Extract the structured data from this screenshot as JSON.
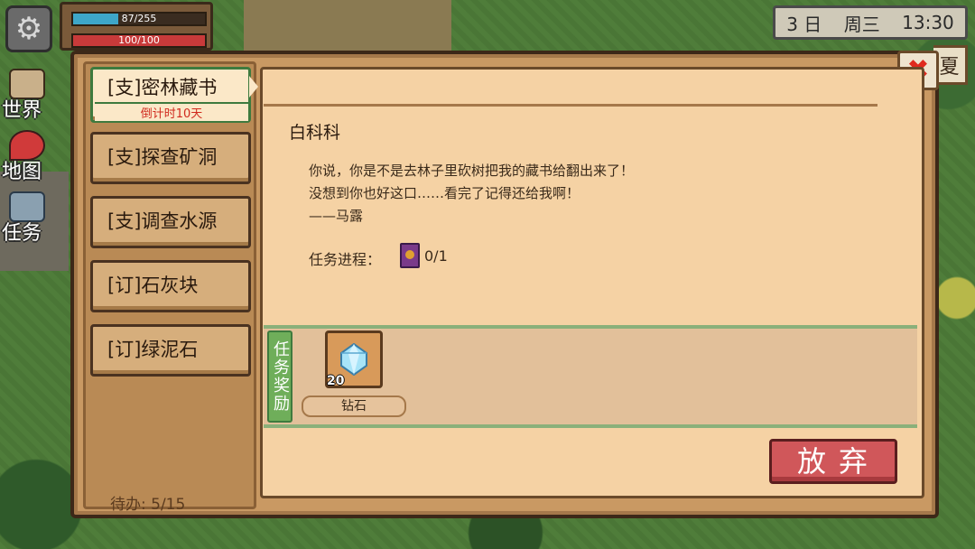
{
  "hud": {
    "energy_text": "87/255",
    "energy_fraction": 0.34,
    "health_text": "100/100",
    "health_fraction": 1.0
  },
  "date": {
    "day": "3 日",
    "weekday": "周三",
    "time": "13:30",
    "season": "夏"
  },
  "side_menu": [
    {
      "label": "世界",
      "icon": "people-icon"
    },
    {
      "label": "地图",
      "icon": "map-pin-icon"
    },
    {
      "label": "任务",
      "icon": "quest-scroll-icon"
    }
  ],
  "quests": [
    {
      "title": "[支]密林藏书",
      "countdown": "倒计时10天",
      "active": true
    },
    {
      "title": "[支]探查矿洞"
    },
    {
      "title": "[支]调查水源"
    },
    {
      "title": "[订]石灰块"
    },
    {
      "title": "[订]绿泥石"
    }
  ],
  "pending": "待办:  5/15",
  "detail": {
    "npc": "白科科",
    "lines": [
      "你说，你是不是去林子里砍树把我的藏书给翻出来了！",
      "没想到你也好这口……看完了记得还给我啊！",
      "——马露"
    ],
    "progress_label": "任务进程：",
    "progress_icon": "book-icon",
    "progress_value": "0/1"
  },
  "reward": {
    "section_label": "任务奖励",
    "items": [
      {
        "name": "钻石",
        "count": "20",
        "icon": "diamond-icon"
      }
    ]
  },
  "buttons": {
    "abandon": "放弃",
    "close_icon": "close-icon",
    "settings_icon": "gear-icon"
  },
  "colors": {
    "accent_red": "#d0575a",
    "panel": "#f5d2a4",
    "frame": "#c99963",
    "reward_green": "#6fae5a"
  }
}
